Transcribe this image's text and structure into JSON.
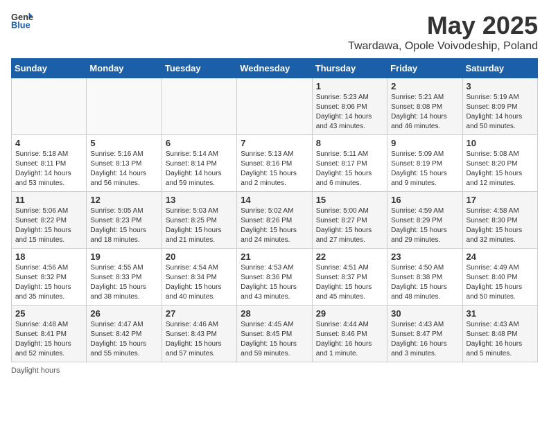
{
  "header": {
    "logo_general": "General",
    "logo_blue": "Blue",
    "month_title": "May 2025",
    "location": "Twardawa, Opole Voivodeship, Poland"
  },
  "days_of_week": [
    "Sunday",
    "Monday",
    "Tuesday",
    "Wednesday",
    "Thursday",
    "Friday",
    "Saturday"
  ],
  "weeks": [
    [
      {
        "day": "",
        "info": ""
      },
      {
        "day": "",
        "info": ""
      },
      {
        "day": "",
        "info": ""
      },
      {
        "day": "",
        "info": ""
      },
      {
        "day": "1",
        "info": "Sunrise: 5:23 AM\nSunset: 8:06 PM\nDaylight: 14 hours\nand 43 minutes."
      },
      {
        "day": "2",
        "info": "Sunrise: 5:21 AM\nSunset: 8:08 PM\nDaylight: 14 hours\nand 46 minutes."
      },
      {
        "day": "3",
        "info": "Sunrise: 5:19 AM\nSunset: 8:09 PM\nDaylight: 14 hours\nand 50 minutes."
      }
    ],
    [
      {
        "day": "4",
        "info": "Sunrise: 5:18 AM\nSunset: 8:11 PM\nDaylight: 14 hours\nand 53 minutes."
      },
      {
        "day": "5",
        "info": "Sunrise: 5:16 AM\nSunset: 8:13 PM\nDaylight: 14 hours\nand 56 minutes."
      },
      {
        "day": "6",
        "info": "Sunrise: 5:14 AM\nSunset: 8:14 PM\nDaylight: 14 hours\nand 59 minutes."
      },
      {
        "day": "7",
        "info": "Sunrise: 5:13 AM\nSunset: 8:16 PM\nDaylight: 15 hours\nand 2 minutes."
      },
      {
        "day": "8",
        "info": "Sunrise: 5:11 AM\nSunset: 8:17 PM\nDaylight: 15 hours\nand 6 minutes."
      },
      {
        "day": "9",
        "info": "Sunrise: 5:09 AM\nSunset: 8:19 PM\nDaylight: 15 hours\nand 9 minutes."
      },
      {
        "day": "10",
        "info": "Sunrise: 5:08 AM\nSunset: 8:20 PM\nDaylight: 15 hours\nand 12 minutes."
      }
    ],
    [
      {
        "day": "11",
        "info": "Sunrise: 5:06 AM\nSunset: 8:22 PM\nDaylight: 15 hours\nand 15 minutes."
      },
      {
        "day": "12",
        "info": "Sunrise: 5:05 AM\nSunset: 8:23 PM\nDaylight: 15 hours\nand 18 minutes."
      },
      {
        "day": "13",
        "info": "Sunrise: 5:03 AM\nSunset: 8:25 PM\nDaylight: 15 hours\nand 21 minutes."
      },
      {
        "day": "14",
        "info": "Sunrise: 5:02 AM\nSunset: 8:26 PM\nDaylight: 15 hours\nand 24 minutes."
      },
      {
        "day": "15",
        "info": "Sunrise: 5:00 AM\nSunset: 8:27 PM\nDaylight: 15 hours\nand 27 minutes."
      },
      {
        "day": "16",
        "info": "Sunrise: 4:59 AM\nSunset: 8:29 PM\nDaylight: 15 hours\nand 29 minutes."
      },
      {
        "day": "17",
        "info": "Sunrise: 4:58 AM\nSunset: 8:30 PM\nDaylight: 15 hours\nand 32 minutes."
      }
    ],
    [
      {
        "day": "18",
        "info": "Sunrise: 4:56 AM\nSunset: 8:32 PM\nDaylight: 15 hours\nand 35 minutes."
      },
      {
        "day": "19",
        "info": "Sunrise: 4:55 AM\nSunset: 8:33 PM\nDaylight: 15 hours\nand 38 minutes."
      },
      {
        "day": "20",
        "info": "Sunrise: 4:54 AM\nSunset: 8:34 PM\nDaylight: 15 hours\nand 40 minutes."
      },
      {
        "day": "21",
        "info": "Sunrise: 4:53 AM\nSunset: 8:36 PM\nDaylight: 15 hours\nand 43 minutes."
      },
      {
        "day": "22",
        "info": "Sunrise: 4:51 AM\nSunset: 8:37 PM\nDaylight: 15 hours\nand 45 minutes."
      },
      {
        "day": "23",
        "info": "Sunrise: 4:50 AM\nSunset: 8:38 PM\nDaylight: 15 hours\nand 48 minutes."
      },
      {
        "day": "24",
        "info": "Sunrise: 4:49 AM\nSunset: 8:40 PM\nDaylight: 15 hours\nand 50 minutes."
      }
    ],
    [
      {
        "day": "25",
        "info": "Sunrise: 4:48 AM\nSunset: 8:41 PM\nDaylight: 15 hours\nand 52 minutes."
      },
      {
        "day": "26",
        "info": "Sunrise: 4:47 AM\nSunset: 8:42 PM\nDaylight: 15 hours\nand 55 minutes."
      },
      {
        "day": "27",
        "info": "Sunrise: 4:46 AM\nSunset: 8:43 PM\nDaylight: 15 hours\nand 57 minutes."
      },
      {
        "day": "28",
        "info": "Sunrise: 4:45 AM\nSunset: 8:45 PM\nDaylight: 15 hours\nand 59 minutes."
      },
      {
        "day": "29",
        "info": "Sunrise: 4:44 AM\nSunset: 8:46 PM\nDaylight: 16 hours\nand 1 minute."
      },
      {
        "day": "30",
        "info": "Sunrise: 4:43 AM\nSunset: 8:47 PM\nDaylight: 16 hours\nand 3 minutes."
      },
      {
        "day": "31",
        "info": "Sunrise: 4:43 AM\nSunset: 8:48 PM\nDaylight: 16 hours\nand 5 minutes."
      }
    ]
  ],
  "footer": {
    "note": "Daylight hours"
  }
}
